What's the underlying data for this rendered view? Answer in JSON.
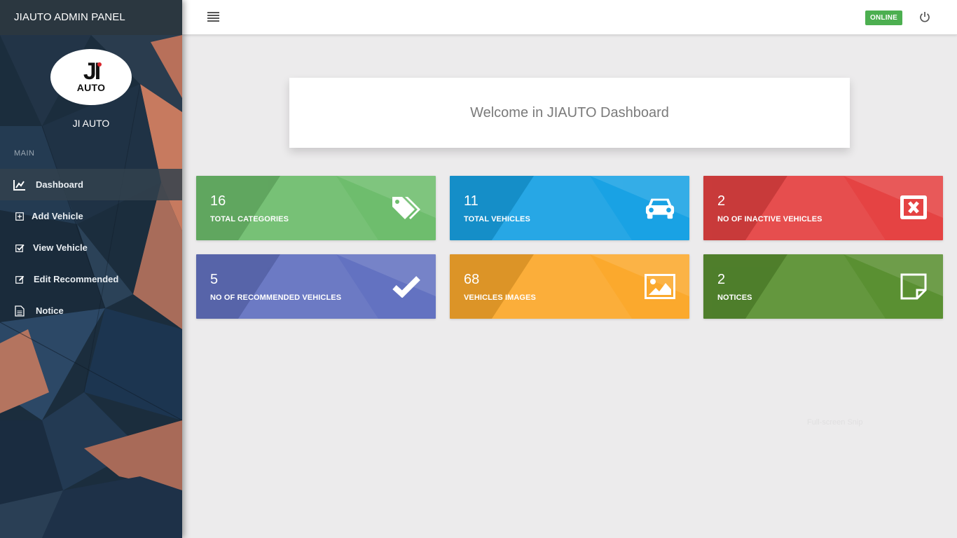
{
  "sidebar": {
    "panel_title": "JIAUTO ADMIN PANEL",
    "logo_text": "AUTO",
    "logo_mark": "JI",
    "brand_name": "JI AUTO",
    "section_label": "MAIN",
    "items": [
      {
        "label": "Dashboard",
        "icon": "line-chart-icon",
        "active": true
      },
      {
        "label": "Add Vehicle",
        "icon": "plus-square-icon"
      },
      {
        "label": "View Vehicle",
        "icon": "check-square-icon"
      },
      {
        "label": "Edit Recommended",
        "icon": "edit-icon"
      },
      {
        "label": "Notice",
        "icon": "file-icon"
      }
    ]
  },
  "topbar": {
    "status": "ONLINE",
    "status_color": "#4caf50"
  },
  "welcome": {
    "text": "Welcome in JIAUTO Dashboard"
  },
  "tiles": [
    {
      "value": "16",
      "label": "TOTAL CATEGORIES",
      "icon": "tags-icon",
      "color": "#6ebd6d"
    },
    {
      "value": "11",
      "label": "TOTAL VEHICLES",
      "icon": "car-icon",
      "color": "#19a2e4"
    },
    {
      "value": "2",
      "label": "NO OF INACTIVE VEHICLES",
      "icon": "close-box-icon",
      "color": "#e54343"
    },
    {
      "value": "5",
      "label": "NO OF RECOMMENDED VEHICLES",
      "icon": "check-icon",
      "color": "#6372c1"
    },
    {
      "value": "68",
      "label": "VEHICLES IMAGES",
      "icon": "image-icon",
      "color": "#fba92d"
    },
    {
      "value": "2",
      "label": "NOTICES",
      "icon": "sticky-note-icon",
      "color": "#5a9032"
    }
  ],
  "overlay_text": "Full-screen Snip"
}
